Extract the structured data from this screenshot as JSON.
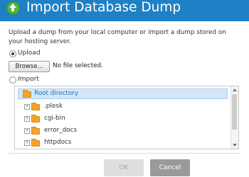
{
  "dialog": {
    "title": "Import Database Dump",
    "description": "Upload a dump from your local computer or import a dump stored on your hosting server."
  },
  "upload": {
    "label": "Upload",
    "selected": true,
    "browse_label": "Browse...",
    "file_status": "No file selected."
  },
  "import": {
    "label": "Import",
    "selected": false
  },
  "tree": {
    "root": "Root directory",
    "items": [
      {
        "label": ".plesk",
        "expander": "+"
      },
      {
        "label": "cgi-bin",
        "expander": "+"
      },
      {
        "label": "error_docs",
        "expander": "+"
      },
      {
        "label": "httpdocs",
        "expander": "+"
      }
    ]
  },
  "buttons": {
    "ok": "OK",
    "cancel": "Cancel"
  },
  "colors": {
    "titlebar": "#1f81c5",
    "selection": "#d4e7f8",
    "folder": "#f3a32b"
  }
}
